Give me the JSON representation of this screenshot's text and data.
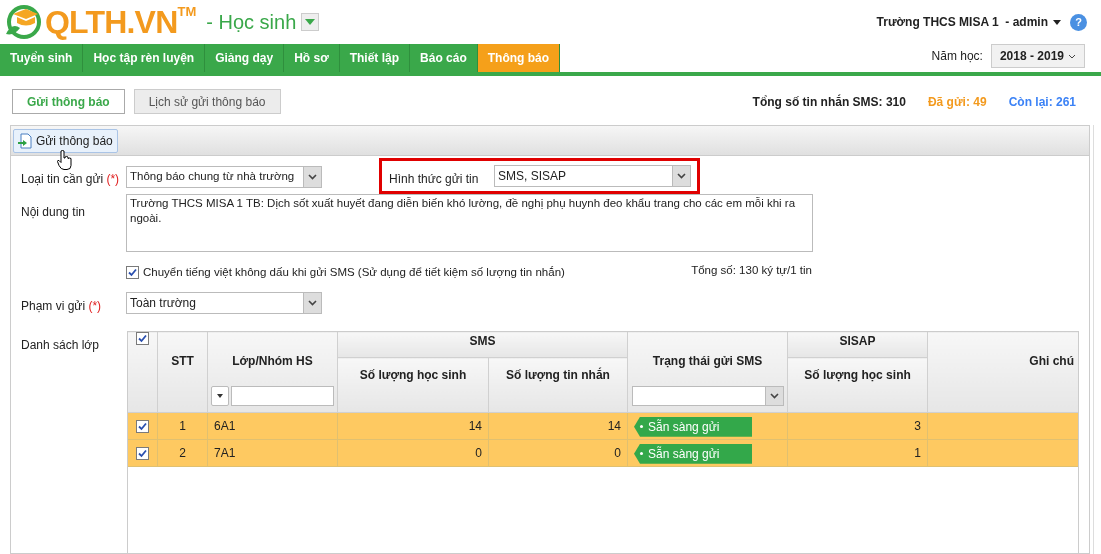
{
  "header": {
    "logo_text": "QLTH.VN",
    "logo_mark": "TM",
    "module": "- Học sinh",
    "user": "Trường THCS MISA 1  - admin",
    "help": "?"
  },
  "nav": [
    {
      "label": "Tuyển sinh",
      "selected": false
    },
    {
      "label": "Học tập rèn luyện",
      "selected": false
    },
    {
      "label": "Giảng dạy",
      "selected": false
    },
    {
      "label": "Hồ sơ",
      "selected": false
    },
    {
      "label": "Thiết lập",
      "selected": false
    },
    {
      "label": "Báo cáo",
      "selected": false
    },
    {
      "label": "Thông báo",
      "selected": true
    }
  ],
  "school_year": {
    "label": "Năm học:",
    "value": "2018 - 2019"
  },
  "subtabs": [
    {
      "label": "Gửi thông báo",
      "selected": true
    },
    {
      "label": "Lịch sử gửi thông báo",
      "selected": false
    }
  ],
  "stats": {
    "total": "Tổng số tin nhắn SMS: 310",
    "sent": "Đã gửi: 49",
    "remaining": "Còn lại: 261"
  },
  "toolbar": {
    "send_button": "Gửi thông báo"
  },
  "form": {
    "type_label": "Loại tin cần gửi",
    "required_mark": "(*)",
    "type_value": "Thông báo chung từ nhà trường",
    "method_label": "Hình thức gửi tin",
    "method_value": "SMS, SISAP",
    "content_label": "Nội dung tin",
    "content_value": "Trường THCS MISA 1 TB: Dịch sốt xuất huyết đang diễn biến khó lường, đề nghị phụ huynh đeo khẩu trang cho các em mỗi khi ra ngoài.",
    "unaccent_checked": true,
    "unaccent_label": "Chuyển tiếng việt không dấu khi gửi SMS (Sử dụng để tiết kiệm số lượng tin nhắn)",
    "char_count": "Tổng số: 130 ký tự/1 tin",
    "scope_label": "Phạm vi gửi",
    "scope_required_mark": "(*)",
    "scope_value": "Toàn trường",
    "list_label": "Danh sách lớp"
  },
  "table": {
    "all_checked": true,
    "columns": {
      "stt": "STT",
      "class": "Lớp/Nhóm HS",
      "sms": "SMS",
      "sms_students": "Số lượng học sinh",
      "sms_messages": "Số lượng tin nhắn",
      "status": "Trạng thái gửi SMS",
      "sisap": "SISAP",
      "sisap_students": "Số lượng học sinh",
      "note": "Ghi chú"
    },
    "rows": [
      {
        "checked": true,
        "stt": "1",
        "class": "6A1",
        "sms_students": "14",
        "sms_messages": "14",
        "status": "Sẵn sàng gửi",
        "sisap_students": "3"
      },
      {
        "checked": true,
        "stt": "2",
        "class": "7A1",
        "sms_students": "0",
        "sms_messages": "0",
        "status": "Sẵn sàng gửi",
        "sisap_students": "1"
      }
    ]
  }
}
